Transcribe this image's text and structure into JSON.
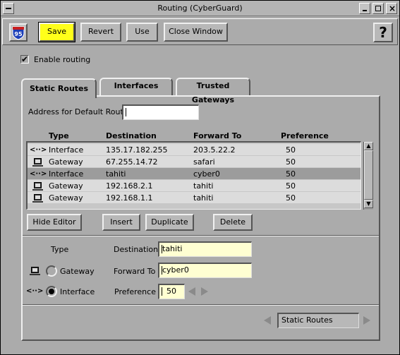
{
  "window": {
    "title": "Routing  (CyberGuard)"
  },
  "toolbar": {
    "app_icon_label": "95",
    "save_label": "Save",
    "revert_label": "Revert",
    "use_label": "Use",
    "close_label": "Close Window",
    "help_label": "?"
  },
  "enable_routing": {
    "label": "Enable routing",
    "checked": true,
    "check_glyph": "✔"
  },
  "tabs": [
    {
      "label": "Static Routes",
      "active": true
    },
    {
      "label": "Interfaces",
      "active": false
    },
    {
      "label": "Trusted Gateways",
      "active": false
    }
  ],
  "default_route": {
    "label": "Address for Default Route",
    "value": ""
  },
  "table": {
    "columns": [
      "Type",
      "Destination",
      "Forward To",
      "Preference"
    ],
    "rows": [
      {
        "icon": "interface-icon",
        "glyph": "<··>",
        "type": "Interface",
        "destination": "135.17.182.255",
        "forward_to": "203.5.22.2",
        "preference": "50",
        "selected": false
      },
      {
        "icon": "gateway-icon",
        "glyph": "",
        "type": "Gateway",
        "destination": "67.255.14.72",
        "forward_to": "safari",
        "preference": "50",
        "selected": false
      },
      {
        "icon": "interface-icon",
        "glyph": "<··>",
        "type": "Interface",
        "destination": "tahiti",
        "forward_to": "cyber0",
        "preference": "50",
        "selected": true
      },
      {
        "icon": "gateway-icon",
        "glyph": "",
        "type": "Gateway",
        "destination": "192.168.2.1",
        "forward_to": "tahiti",
        "preference": "50",
        "selected": false
      },
      {
        "icon": "gateway-icon",
        "glyph": "",
        "type": "Gateway",
        "destination": "192.168.1.1",
        "forward_to": "tahiti",
        "preference": "50",
        "selected": false
      }
    ]
  },
  "buttons": {
    "hide_editor": "Hide Editor",
    "insert": "Insert",
    "duplicate": "Duplicate",
    "delete": "Delete"
  },
  "editor": {
    "type_label": "Type",
    "gateway_label": "Gateway",
    "interface_label": "Interface",
    "interface_glyph": "<··>",
    "selected_type": "Interface",
    "destination_label": "Destination",
    "destination_value": "tahiti",
    "forward_to_label": "Forward To",
    "forward_to_value": "cyber0",
    "preference_label": "Preference",
    "preference_value": "50"
  },
  "pager": {
    "current": "Static Routes"
  },
  "colors": {
    "window_bg": "#ababab",
    "default_button": "#ffff1a",
    "field_yellow": "#ffffd2",
    "selected_row": "#9c9c9c"
  }
}
